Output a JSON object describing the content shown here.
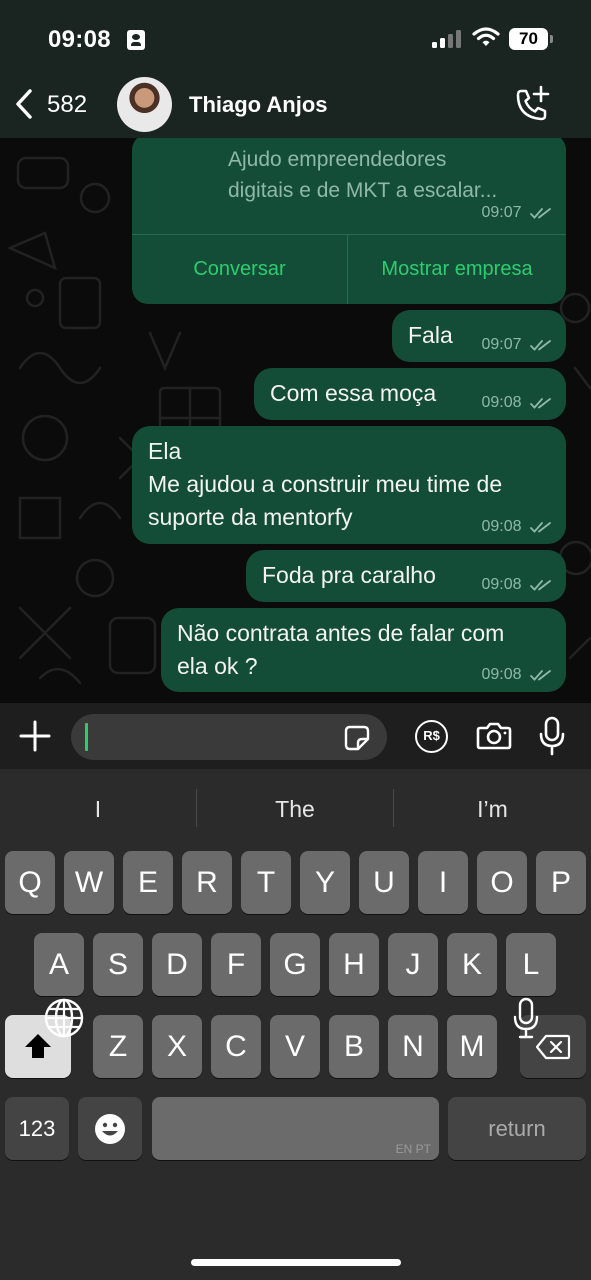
{
  "status": {
    "time": "09:08",
    "battery": "70"
  },
  "header": {
    "back_count": "582",
    "contact_name": "Thiago Anjos"
  },
  "card": {
    "lines": [
      "Ajudo empreendedores",
      "digitais e de MKT a escalar..."
    ],
    "time": "09:07",
    "buttons": [
      "Conversar",
      "Mostrar empresa"
    ]
  },
  "messages": [
    {
      "lines": [
        "Fala"
      ],
      "time": "09:07"
    },
    {
      "lines": [
        "Com essa moça"
      ],
      "time": "09:08"
    },
    {
      "lines": [
        "Ela",
        "Me ajudou a construir meu time de",
        "suporte da mentorfy"
      ],
      "time": "09:08"
    },
    {
      "lines": [
        "Foda pra caralho"
      ],
      "time": "09:08"
    },
    {
      "lines": [
        "Não contrata antes de falar com",
        "ela ok ?"
      ],
      "time": "09:08"
    }
  ],
  "input": {
    "pay_label": "R$"
  },
  "keyboard": {
    "suggestions": [
      "I",
      "The",
      "I’m"
    ],
    "row1": [
      "Q",
      "W",
      "E",
      "R",
      "T",
      "Y",
      "U",
      "I",
      "O",
      "P"
    ],
    "row2": [
      "A",
      "S",
      "D",
      "F",
      "G",
      "H",
      "J",
      "K",
      "L"
    ],
    "row3": [
      "Z",
      "X",
      "C",
      "V",
      "B",
      "N",
      "M"
    ],
    "numbers_label": "123",
    "space_hint": "EN PT",
    "return_label": "return"
  }
}
